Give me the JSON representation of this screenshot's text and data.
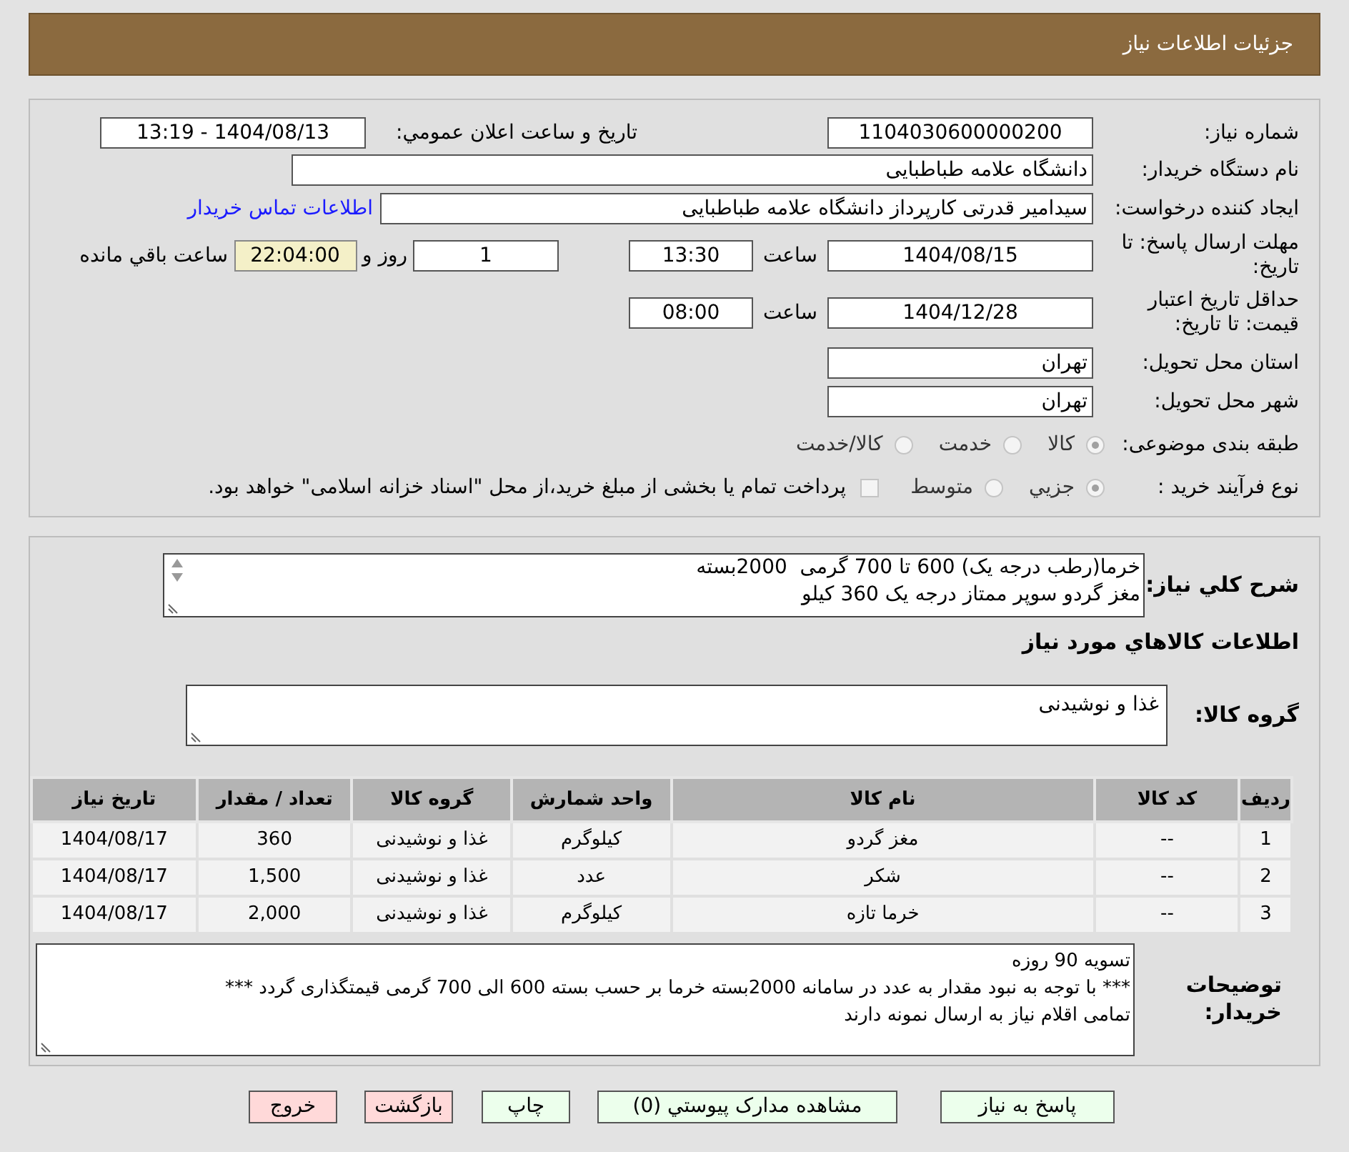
{
  "header": {
    "title": "جزئیات اطلاعات نیاز"
  },
  "need_number": {
    "label": "شماره نیاز:",
    "value": "1104030600000200"
  },
  "announce": {
    "label": "تاريخ و ساعت اعلان عمومي:",
    "value": "1404/08/13 - 13:19"
  },
  "buyer_org": {
    "label": "نام دستگاه خریدار:",
    "value": "دانشگاه علامه طباطبایی"
  },
  "requester": {
    "label": "ایجاد کننده درخواست:",
    "value": "سیدامیر قدرتی کارپرداز دانشگاه علامه طباطبایی",
    "link": "اطلاعات تماس خریدار"
  },
  "deadline": {
    "label": "مهلت ارسال پاسخ: تا تاریخ:",
    "date": "1404/08/15",
    "time_label": "ساعت",
    "time": "13:30",
    "days": "1",
    "days_label": "روز و",
    "remaining": "22:04:00",
    "remaining_label": "ساعت باقي مانده"
  },
  "validity": {
    "label": "حداقل تاریخ اعتبار قیمت: تا تاریخ:",
    "date": "1404/12/28",
    "time_label": "ساعت",
    "time": "08:00"
  },
  "province": {
    "label": "استان محل تحویل:",
    "value": "تهران"
  },
  "city": {
    "label": "شهر محل تحویل:",
    "value": "تهران"
  },
  "category": {
    "label": "طبقه بندی موضوعی:",
    "options": [
      {
        "label": "کالا",
        "selected": true
      },
      {
        "label": "خدمت",
        "selected": false
      },
      {
        "label": "کالا/خدمت",
        "selected": false
      }
    ]
  },
  "process": {
    "label": "نوع فرآیند خرید :",
    "options": [
      {
        "label": "جزيي",
        "selected": true
      },
      {
        "label": "متوسط",
        "selected": false
      }
    ],
    "checkbox": {
      "checked": false,
      "label": "پرداخت تمام یا بخشی از مبلغ خرید،از محل \"اسناد خزانه اسلامی\" خواهد بود."
    }
  },
  "summary": {
    "label": "شرح کلي نیاز:",
    "value": "خرما(رطب درجه یک) 600 تا 700 گرمی  2000بسته\nمغز گردو سوپر ممتاز درجه یک 360 کیلو"
  },
  "items_heading": "اطلاعات کالاهاي مورد نیاز",
  "goods_group": {
    "label": "گروه کالا:",
    "value": "غذا و نوشیدنی"
  },
  "table": {
    "columns": [
      "ردیف",
      "کد کالا",
      "نام کالا",
      "واحد شمارش",
      "گروه کالا",
      "تعداد / مقدار",
      "تاریخ نیاز"
    ],
    "rows": [
      [
        "1",
        "--",
        "مغز گردو",
        "کیلوگرم",
        "غذا و نوشیدنی",
        "360",
        "1404/08/17"
      ],
      [
        "2",
        "--",
        "شکر",
        "عدد",
        "غذا و نوشیدنی",
        "1,500",
        "1404/08/17"
      ],
      [
        "3",
        "--",
        "خرما تازه",
        "کیلوگرم",
        "غذا و نوشیدنی",
        "2,000",
        "1404/08/17"
      ]
    ]
  },
  "buyer_notes": {
    "label": "توضیحات خریدار:",
    "value": "تسویه 90 روزه\n*** با توجه به نبود مقدار به عدد در سامانه 2000بسته خرما بر حسب بسته 600 الی 700 گرمی قیمتگذاری گردد ***\nتمامی اقلام نیاز به ارسال نمونه دارند"
  },
  "buttons": [
    {
      "label": "پاسخ به نیاز",
      "kind": "normal"
    },
    {
      "label": "مشاهده مدارک پیوستي (0)",
      "kind": "normal"
    },
    {
      "label": "چاپ",
      "kind": "normal"
    },
    {
      "label": "بازگشت",
      "kind": "danger"
    },
    {
      "label": "خروج",
      "kind": "danger"
    }
  ]
}
